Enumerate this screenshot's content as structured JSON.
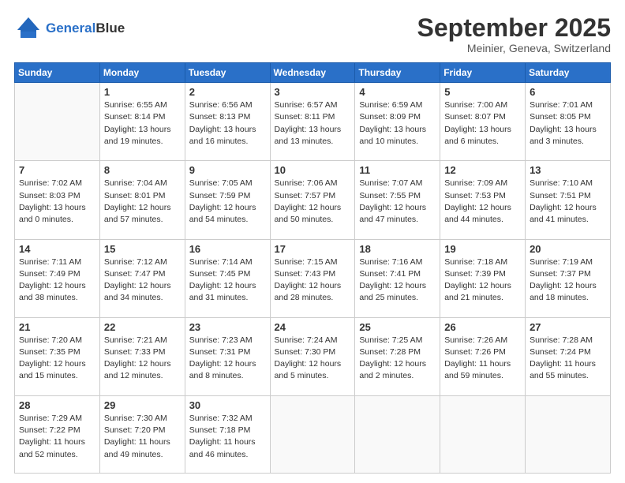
{
  "header": {
    "logo_line1": "General",
    "logo_line2": "Blue",
    "month": "September 2025",
    "location": "Meinier, Geneva, Switzerland"
  },
  "weekdays": [
    "Sunday",
    "Monday",
    "Tuesday",
    "Wednesday",
    "Thursday",
    "Friday",
    "Saturday"
  ],
  "weeks": [
    [
      {
        "day": "",
        "info": ""
      },
      {
        "day": "1",
        "info": "Sunrise: 6:55 AM\nSunset: 8:14 PM\nDaylight: 13 hours\nand 19 minutes."
      },
      {
        "day": "2",
        "info": "Sunrise: 6:56 AM\nSunset: 8:13 PM\nDaylight: 13 hours\nand 16 minutes."
      },
      {
        "day": "3",
        "info": "Sunrise: 6:57 AM\nSunset: 8:11 PM\nDaylight: 13 hours\nand 13 minutes."
      },
      {
        "day": "4",
        "info": "Sunrise: 6:59 AM\nSunset: 8:09 PM\nDaylight: 13 hours\nand 10 minutes."
      },
      {
        "day": "5",
        "info": "Sunrise: 7:00 AM\nSunset: 8:07 PM\nDaylight: 13 hours\nand 6 minutes."
      },
      {
        "day": "6",
        "info": "Sunrise: 7:01 AM\nSunset: 8:05 PM\nDaylight: 13 hours\nand 3 minutes."
      }
    ],
    [
      {
        "day": "7",
        "info": "Sunrise: 7:02 AM\nSunset: 8:03 PM\nDaylight: 13 hours\nand 0 minutes."
      },
      {
        "day": "8",
        "info": "Sunrise: 7:04 AM\nSunset: 8:01 PM\nDaylight: 12 hours\nand 57 minutes."
      },
      {
        "day": "9",
        "info": "Sunrise: 7:05 AM\nSunset: 7:59 PM\nDaylight: 12 hours\nand 54 minutes."
      },
      {
        "day": "10",
        "info": "Sunrise: 7:06 AM\nSunset: 7:57 PM\nDaylight: 12 hours\nand 50 minutes."
      },
      {
        "day": "11",
        "info": "Sunrise: 7:07 AM\nSunset: 7:55 PM\nDaylight: 12 hours\nand 47 minutes."
      },
      {
        "day": "12",
        "info": "Sunrise: 7:09 AM\nSunset: 7:53 PM\nDaylight: 12 hours\nand 44 minutes."
      },
      {
        "day": "13",
        "info": "Sunrise: 7:10 AM\nSunset: 7:51 PM\nDaylight: 12 hours\nand 41 minutes."
      }
    ],
    [
      {
        "day": "14",
        "info": "Sunrise: 7:11 AM\nSunset: 7:49 PM\nDaylight: 12 hours\nand 38 minutes."
      },
      {
        "day": "15",
        "info": "Sunrise: 7:12 AM\nSunset: 7:47 PM\nDaylight: 12 hours\nand 34 minutes."
      },
      {
        "day": "16",
        "info": "Sunrise: 7:14 AM\nSunset: 7:45 PM\nDaylight: 12 hours\nand 31 minutes."
      },
      {
        "day": "17",
        "info": "Sunrise: 7:15 AM\nSunset: 7:43 PM\nDaylight: 12 hours\nand 28 minutes."
      },
      {
        "day": "18",
        "info": "Sunrise: 7:16 AM\nSunset: 7:41 PM\nDaylight: 12 hours\nand 25 minutes."
      },
      {
        "day": "19",
        "info": "Sunrise: 7:18 AM\nSunset: 7:39 PM\nDaylight: 12 hours\nand 21 minutes."
      },
      {
        "day": "20",
        "info": "Sunrise: 7:19 AM\nSunset: 7:37 PM\nDaylight: 12 hours\nand 18 minutes."
      }
    ],
    [
      {
        "day": "21",
        "info": "Sunrise: 7:20 AM\nSunset: 7:35 PM\nDaylight: 12 hours\nand 15 minutes."
      },
      {
        "day": "22",
        "info": "Sunrise: 7:21 AM\nSunset: 7:33 PM\nDaylight: 12 hours\nand 12 minutes."
      },
      {
        "day": "23",
        "info": "Sunrise: 7:23 AM\nSunset: 7:31 PM\nDaylight: 12 hours\nand 8 minutes."
      },
      {
        "day": "24",
        "info": "Sunrise: 7:24 AM\nSunset: 7:30 PM\nDaylight: 12 hours\nand 5 minutes."
      },
      {
        "day": "25",
        "info": "Sunrise: 7:25 AM\nSunset: 7:28 PM\nDaylight: 12 hours\nand 2 minutes."
      },
      {
        "day": "26",
        "info": "Sunrise: 7:26 AM\nSunset: 7:26 PM\nDaylight: 11 hours\nand 59 minutes."
      },
      {
        "day": "27",
        "info": "Sunrise: 7:28 AM\nSunset: 7:24 PM\nDaylight: 11 hours\nand 55 minutes."
      }
    ],
    [
      {
        "day": "28",
        "info": "Sunrise: 7:29 AM\nSunset: 7:22 PM\nDaylight: 11 hours\nand 52 minutes."
      },
      {
        "day": "29",
        "info": "Sunrise: 7:30 AM\nSunset: 7:20 PM\nDaylight: 11 hours\nand 49 minutes."
      },
      {
        "day": "30",
        "info": "Sunrise: 7:32 AM\nSunset: 7:18 PM\nDaylight: 11 hours\nand 46 minutes."
      },
      {
        "day": "",
        "info": ""
      },
      {
        "day": "",
        "info": ""
      },
      {
        "day": "",
        "info": ""
      },
      {
        "day": "",
        "info": ""
      }
    ]
  ]
}
